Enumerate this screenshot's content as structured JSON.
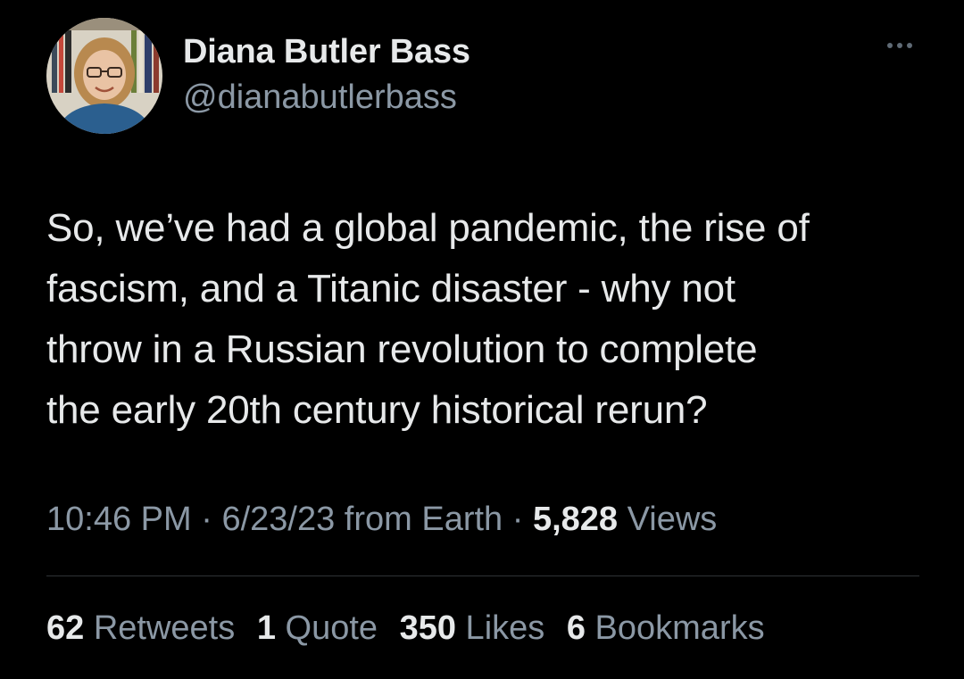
{
  "tweet": {
    "author": {
      "display_name": "Diana Butler Bass",
      "handle": "@dianabutlerbass"
    },
    "text_lines": [
      "So, we’ve had a global pandemic, the rise of",
      "fascism, and a Titanic disaster - why not",
      "throw in a Russian revolution to complete",
      "the early 20th century historical rerun?"
    ],
    "meta": {
      "time": "10:46 PM",
      "sep1": " · ",
      "date": "6/23/23",
      "source": " from Earth",
      "sep2": " · ",
      "views_count": "5,828",
      "views_label": " Views"
    },
    "stats": {
      "retweets": {
        "count": "62",
        "label": " Retweets"
      },
      "quotes": {
        "count": "1",
        "label": " Quote"
      },
      "likes": {
        "count": "350",
        "label": " Likes"
      },
      "bookmarks": {
        "count": "6",
        "label": " Bookmarks"
      }
    },
    "icons": {
      "more": "more-horizontal-icon"
    },
    "colors": {
      "background": "#000000",
      "primary_text": "#e7e9ea",
      "secondary_text": "#8b98a5",
      "divider": "#2f3336"
    }
  }
}
